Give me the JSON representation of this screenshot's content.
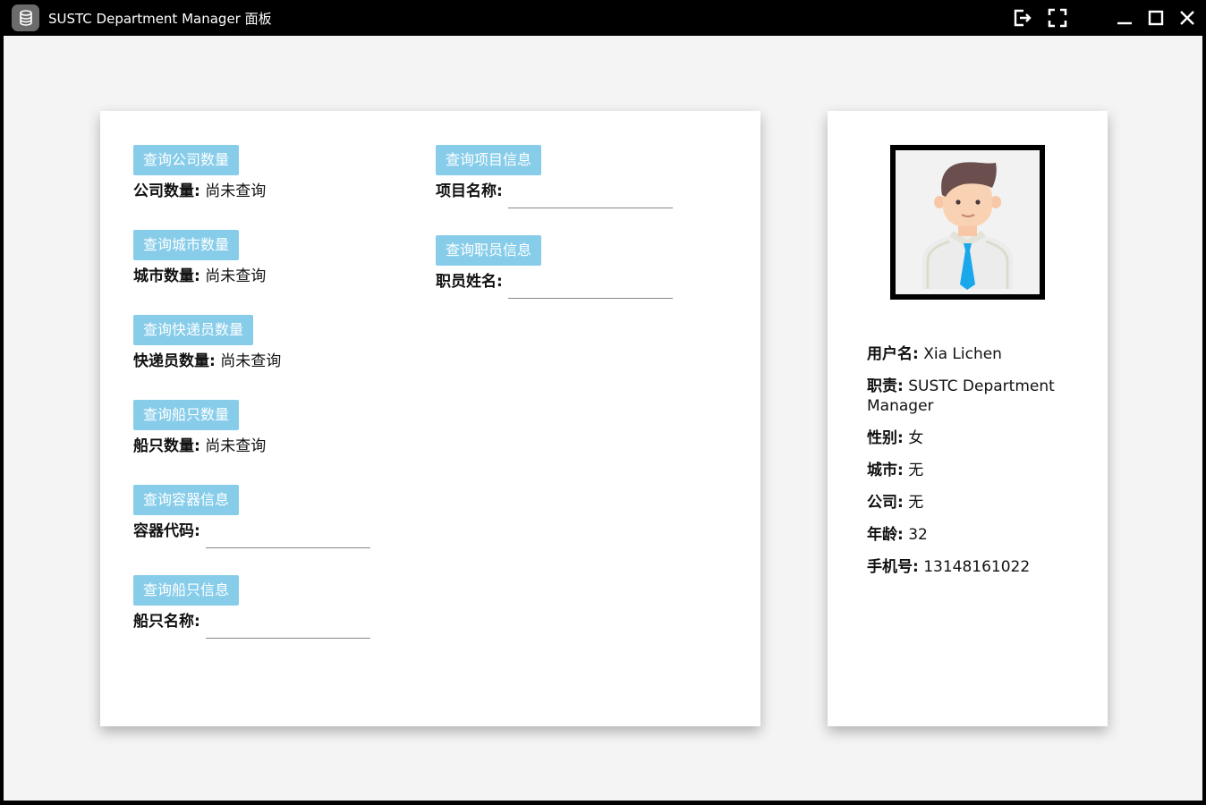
{
  "window": {
    "title": "SUSTC Department Manager 面板",
    "app_icon": "database-icon",
    "controls": [
      "logout-icon",
      "fullscreen-icon",
      "minimize-icon",
      "maximize-icon",
      "close-icon"
    ]
  },
  "queries": {
    "company_count": {
      "button": "查询公司数量",
      "label": "公司数量:",
      "value": "尚未查询"
    },
    "city_count": {
      "button": "查询城市数量",
      "label": "城市数量:",
      "value": "尚未查询"
    },
    "courier_count": {
      "button": "查询快递员数量",
      "label": "快递员数量:",
      "value": "尚未查询"
    },
    "ship_count": {
      "button": "查询船只数量",
      "label": "船只数量:",
      "value": "尚未查询"
    },
    "container_info": {
      "button": "查询容器信息",
      "label": "容器代码:",
      "input_value": ""
    },
    "ship_info": {
      "button": "查询船只信息",
      "label": "船只名称:",
      "input_value": ""
    },
    "project_info": {
      "button": "查询项目信息",
      "label": "项目名称:",
      "input_value": ""
    },
    "staff_info": {
      "button": "查询职员信息",
      "label": "职员姓名:",
      "input_value": ""
    }
  },
  "profile": {
    "avatar": "user-avatar-icon",
    "username": {
      "label": "用户名:",
      "value": "Xia Lichen"
    },
    "role": {
      "label": "职责:",
      "value": "SUSTC Department Manager"
    },
    "gender": {
      "label": "性别:",
      "value": "女"
    },
    "city": {
      "label": "城市:",
      "value": "无"
    },
    "company": {
      "label": "公司:",
      "value": "无"
    },
    "age": {
      "label": "年龄:",
      "value": "32"
    },
    "phone": {
      "label": "手机号:",
      "value": "13148161022"
    }
  },
  "colors": {
    "button_bg": "#87cdea",
    "titlebar_bg": "#000000",
    "content_bg": "#f4f4f4",
    "card_bg": "#ffffff"
  }
}
